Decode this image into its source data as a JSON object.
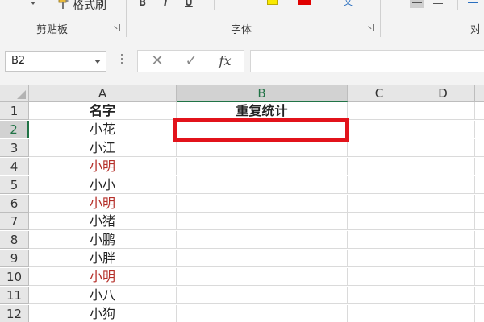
{
  "ribbon": {
    "clipboard": {
      "label": "剪贴板",
      "format_painter_label": "格式刷"
    },
    "font": {
      "label": "字体",
      "bold_glyph": "B",
      "italic_glyph": "I",
      "underline_glyph": "U",
      "wen_glyph": "文"
    },
    "alignment": {
      "label": "对齐"
    }
  },
  "formula_bar": {
    "name_box": "B2",
    "cancel_glyph": "✕",
    "enter_glyph": "✓",
    "fx_glyph": "fx",
    "formula": ""
  },
  "sheet": {
    "columns": [
      "A",
      "B",
      "C",
      "D"
    ],
    "selected_column": "B",
    "rows": [
      {
        "num": "1",
        "a": "名字",
        "b": "重复统计",
        "style": "header"
      },
      {
        "num": "2",
        "a": "小花",
        "b": "",
        "style": "normal"
      },
      {
        "num": "3",
        "a": "小江",
        "b": "",
        "style": "normal"
      },
      {
        "num": "4",
        "a": "小明",
        "b": "",
        "style": "dup"
      },
      {
        "num": "5",
        "a": "小小",
        "b": "",
        "style": "normal"
      },
      {
        "num": "6",
        "a": "小明",
        "b": "",
        "style": "dup"
      },
      {
        "num": "7",
        "a": "小猪",
        "b": "",
        "style": "normal"
      },
      {
        "num": "8",
        "a": "小鹏",
        "b": "",
        "style": "normal"
      },
      {
        "num": "9",
        "a": "小胖",
        "b": "",
        "style": "normal"
      },
      {
        "num": "10",
        "a": "小明",
        "b": "",
        "style": "dup"
      },
      {
        "num": "11",
        "a": "小八",
        "b": "",
        "style": "normal"
      },
      {
        "num": "12",
        "a": "小狗",
        "b": "",
        "style": "normal"
      }
    ],
    "selected_row": "2",
    "selected_cell": "B2"
  },
  "colors": {
    "accent_green": "#217346",
    "duplicate_text": "#b5302a",
    "highlight_box": "#e2131b"
  }
}
